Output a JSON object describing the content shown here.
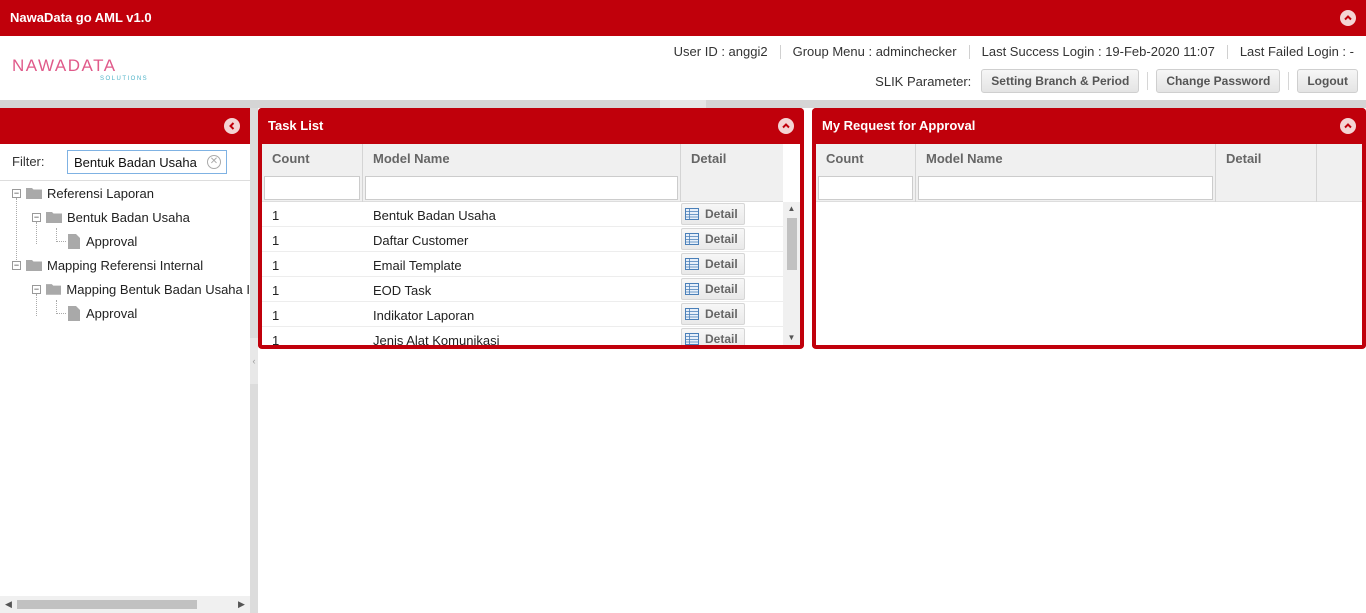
{
  "app": {
    "title": "NawaData go AML v1.0"
  },
  "logo": {
    "main": "NAWADATA",
    "sub": "SOLUTIONS"
  },
  "header": {
    "user_id": "User ID : anggi2",
    "group_menu": "Group Menu : adminchecker",
    "last_success": "Last Success Login : 19-Feb-2020 11:07",
    "last_failed": "Last Failed Login : -",
    "slik_label": "SLIK Parameter:",
    "buttons": {
      "setting": "Setting Branch & Period",
      "change_password": "Change Password",
      "logout": "Logout"
    }
  },
  "tree": {
    "filter_label": "Filter:",
    "filter_value": "Bentuk Badan Usaha",
    "nodes": [
      {
        "label": "Referensi Laporan",
        "type": "folder"
      },
      {
        "label": "Bentuk Badan Usaha",
        "type": "folder"
      },
      {
        "label": "Approval",
        "type": "file"
      },
      {
        "label": "Mapping Referensi Internal",
        "type": "folder"
      },
      {
        "label": "Mapping Bentuk Badan Usaha I",
        "type": "folder"
      },
      {
        "label": "Approval",
        "type": "file"
      }
    ]
  },
  "task_list": {
    "title": "Task List",
    "columns": [
      "Count",
      "Model Name",
      "Detail"
    ],
    "detail_label": "Detail",
    "rows": [
      {
        "count": "1",
        "model": "Bentuk Badan Usaha"
      },
      {
        "count": "1",
        "model": "Daftar Customer"
      },
      {
        "count": "1",
        "model": "Email Template"
      },
      {
        "count": "1",
        "model": "EOD Task"
      },
      {
        "count": "1",
        "model": "Indikator Laporan"
      },
      {
        "count": "1",
        "model": "Jenis Alat Komunikasi"
      }
    ]
  },
  "approval": {
    "title": "My Request for Approval",
    "columns": [
      "Count",
      "Model Name",
      "Detail"
    ]
  },
  "colors": {
    "brand": "#c0000b"
  }
}
